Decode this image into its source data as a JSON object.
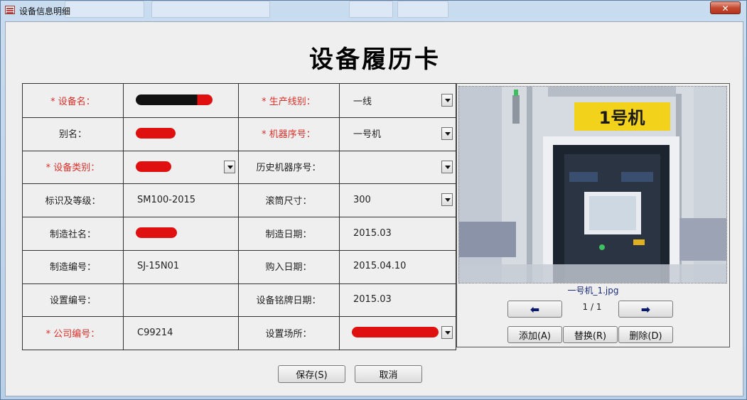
{
  "window": {
    "title": "设备信息明细",
    "close_glyph": "✕"
  },
  "heading": "设备履历卡",
  "form": {
    "rows": [
      {
        "left_label": "设备名：",
        "left_required": true,
        "left_value": "",
        "left_dropdown": false,
        "right_label": "生产线别：",
        "right_required": true,
        "right_value": "一线",
        "right_dropdown": true
      },
      {
        "left_label": "别名：",
        "left_required": false,
        "left_value": "",
        "left_dropdown": false,
        "right_label": "机器序号：",
        "right_required": true,
        "right_value": "一号机",
        "right_dropdown": true
      },
      {
        "left_label": "设备类别：",
        "left_required": true,
        "left_value": "",
        "left_dropdown": true,
        "right_label": "历史机器序号：",
        "right_required": false,
        "right_value": "",
        "right_dropdown": true
      },
      {
        "left_label": "标识及等级：",
        "left_required": false,
        "left_value": "SM100-2015",
        "left_dropdown": false,
        "right_label": "滚筒尺寸：",
        "right_required": false,
        "right_value": "300",
        "right_dropdown": true
      },
      {
        "left_label": "制造社名：",
        "left_required": false,
        "left_value": "",
        "left_dropdown": false,
        "right_label": "制造日期：",
        "right_required": false,
        "right_value": "2015.03",
        "right_dropdown": false
      },
      {
        "left_label": "制造编号：",
        "left_required": false,
        "left_value": "SJ-15N01",
        "left_dropdown": false,
        "right_label": "购入日期：",
        "right_required": false,
        "right_value": "2015.04.10",
        "right_dropdown": false
      },
      {
        "left_label": "设置编号：",
        "left_required": false,
        "left_value": "",
        "left_dropdown": false,
        "right_label": "设备铭牌日期：",
        "right_required": false,
        "right_value": "2015.03",
        "right_dropdown": false
      },
      {
        "left_label": "公司编号：",
        "left_required": true,
        "left_value": "C99214",
        "left_dropdown": false,
        "right_label": "设置场所：",
        "right_required": false,
        "right_value": "",
        "right_dropdown": true
      }
    ],
    "required_mark": "* "
  },
  "photo": {
    "machine_sign": "1号机",
    "filename": "一号机_1.jpg",
    "page_indicator": "1 / 1",
    "prev_glyph": "⬅",
    "next_glyph": "➡",
    "add_label": "添加(A)",
    "replace_label": "替换(R)",
    "delete_label": "删除(D)"
  },
  "actions": {
    "save_label": "保存(S)",
    "cancel_label": "取消"
  },
  "colors": {
    "required": "#d8302a",
    "redaction": "#e01010",
    "sign_yellow": "#f2d21a"
  }
}
